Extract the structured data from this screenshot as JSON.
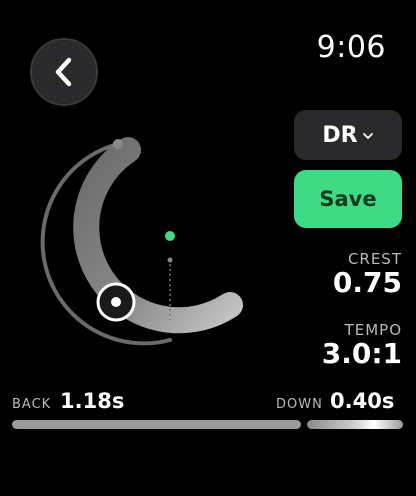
{
  "status_bar": {
    "time": "9:06"
  },
  "icons": {
    "back": "chevron-left-icon",
    "mode_dropdown": "chevron-down-icon"
  },
  "controls": {
    "mode_label": "DR",
    "save_label": "Save"
  },
  "stats": {
    "crest_label": "CREST",
    "crest_value": "0.75",
    "tempo_label": "TEMPO",
    "tempo_value": "3.0:1"
  },
  "timing": {
    "back_label": "BACK",
    "back_value": "1.18s",
    "down_label": "DOWN",
    "down_value": "0.40s"
  },
  "colors": {
    "background": "#000000",
    "accent_green": "#3ddc84",
    "control_bg": "#2a2a2c"
  }
}
